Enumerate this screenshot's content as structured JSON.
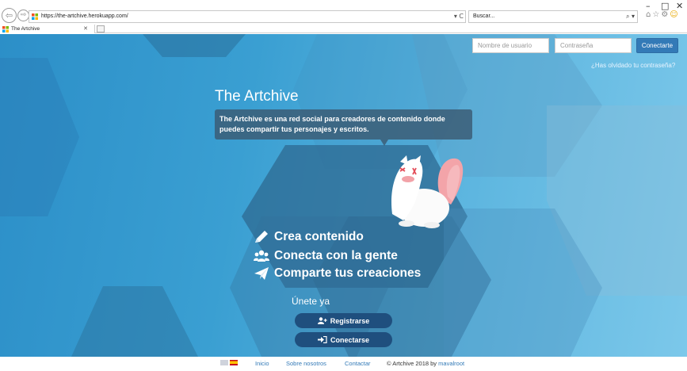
{
  "browser": {
    "url": "https://the-artchive.herokuapp.com/",
    "search_placeholder": "Buscar...",
    "tab_title": "The Artchive",
    "win_minimize": "–",
    "win_maximize": "□",
    "win_close": "✕",
    "address_refresh": "▾ C",
    "search_icon": "⌕ ▾",
    "toolbar_icons": [
      "home-icon",
      "star-icon",
      "settings-gear-icon",
      "smiley-icon"
    ]
  },
  "login": {
    "username_placeholder": "Nombre de usuario",
    "password_placeholder": "Contraseña",
    "submit_label": "Conectarte",
    "forgot_label": "¿Has olvidado tu contraseña?"
  },
  "hero": {
    "title": "The Artchive",
    "description": "The Artchive es una red social para creadores de contenido donde puedes compartir tus personajes y escritos."
  },
  "features": [
    {
      "icon": "pencil-icon",
      "label": "Crea contenido"
    },
    {
      "icon": "users-icon",
      "label": "Conecta con la gente"
    },
    {
      "icon": "paper-plane-icon",
      "label": "Comparte tus creaciones"
    }
  ],
  "join": {
    "label": "Únete ya",
    "register_label": "Registrarse",
    "connect_label": "Conectarse"
  },
  "footer": {
    "links": [
      "Inicio",
      "Sobre nosotros",
      "Contactar"
    ],
    "copyright": "© Artchive 2018 by",
    "author": "mavalroot"
  },
  "colors": {
    "primary_button": "#337ab7",
    "cta_button": "#1f4f7e",
    "background_start": "#2c8fc8",
    "background_end": "#7cc8ea"
  }
}
